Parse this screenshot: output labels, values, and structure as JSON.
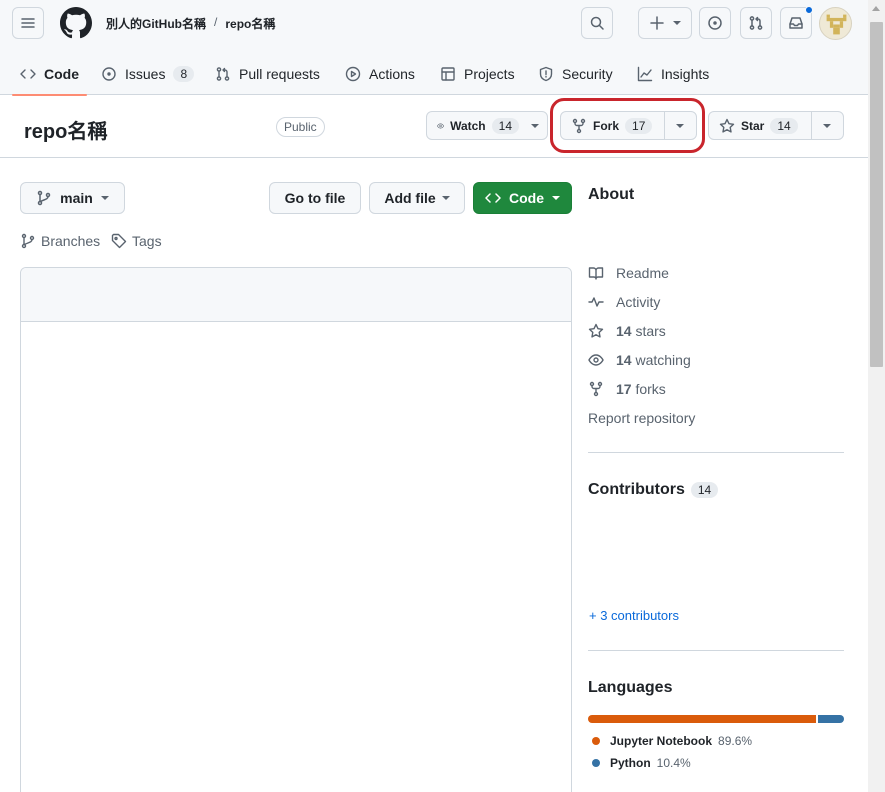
{
  "header": {
    "owner": "別人的GitHub名稱",
    "separator": "/",
    "repo": "repo名稱"
  },
  "nav": {
    "tabs": [
      {
        "label": "Code",
        "icon": "code-icon"
      },
      {
        "label": "Issues",
        "icon": "issue-icon",
        "count": "8"
      },
      {
        "label": "Pull requests",
        "icon": "pull-request-icon"
      },
      {
        "label": "Actions",
        "icon": "play-icon"
      },
      {
        "label": "Projects",
        "icon": "table-icon"
      },
      {
        "label": "Security",
        "icon": "shield-icon"
      },
      {
        "label": "Insights",
        "icon": "graph-icon"
      }
    ]
  },
  "repo_header": {
    "title": "repo名稱",
    "visibility": "Public",
    "watch_label": "Watch",
    "watch_count": "14",
    "fork_label": "Fork",
    "fork_count": "17",
    "star_label": "Star",
    "star_count": "14"
  },
  "toolbar": {
    "branch": "main",
    "go_to_file": "Go to file",
    "add_file": "Add file",
    "code": "Code",
    "branches": "Branches",
    "tags": "Tags"
  },
  "about": {
    "heading": "About",
    "links": [
      {
        "icon": "book-icon",
        "label": "Readme"
      },
      {
        "icon": "pulse-icon",
        "label": "Activity"
      },
      {
        "icon": "star-icon",
        "count": "14",
        "label": "stars"
      },
      {
        "icon": "eye-icon",
        "count": "14",
        "label": "watching"
      },
      {
        "icon": "fork-icon",
        "count": "17",
        "label": "forks"
      }
    ],
    "report": "Report repository"
  },
  "contributors": {
    "heading": "Contributors",
    "count": "14",
    "more": "+ 3 contributors"
  },
  "languages": {
    "heading": "Languages",
    "items": [
      {
        "name": "Jupyter Notebook",
        "percent": "89.6%",
        "share": 89.6,
        "color": "#DA5B0B"
      },
      {
        "name": "Python",
        "percent": "10.4%",
        "share": 10.4,
        "color": "#3572A5"
      }
    ]
  },
  "colors": {
    "accent_green": "#1f883d",
    "underline": "#fd8c73",
    "highlight_ring": "#c9252c",
    "link_blue": "#0969da"
  }
}
